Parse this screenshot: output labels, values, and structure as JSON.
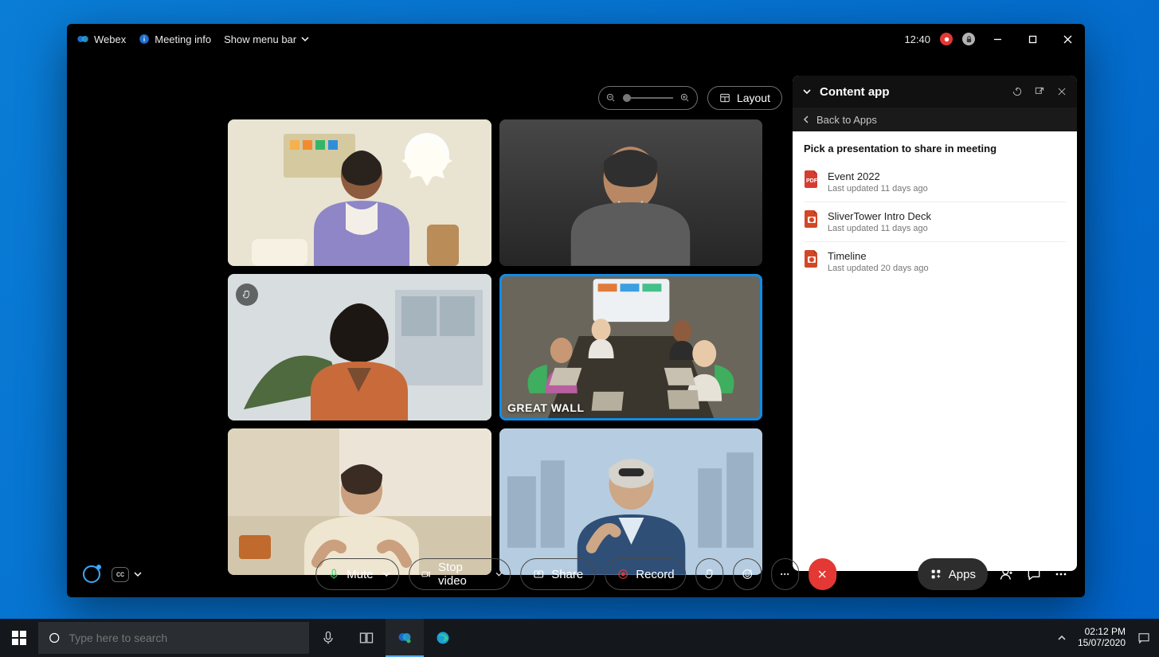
{
  "app": {
    "brand": "Webex",
    "meeting_info": "Meeting info",
    "menubar": "Show menu bar"
  },
  "header": {
    "time": "12:40",
    "layout": "Layout"
  },
  "tiles": {
    "row2col2_name": "GREAT WALL"
  },
  "panel": {
    "title": "Content app",
    "back": "Back to Apps",
    "prompt": "Pick a presentation to share in meeting",
    "items": [
      {
        "name": "Event 2022",
        "sub": "Last updated 11 days ago",
        "type": "pdf"
      },
      {
        "name": "SliverTower Intro Deck",
        "sub": "Last updated 11 days ago",
        "type": "ppt"
      },
      {
        "name": "Timeline",
        "sub": "Last updated 20 days ago",
        "type": "ppt"
      }
    ]
  },
  "bottom": {
    "mute": "Mute",
    "stop_video": "Stop video",
    "share": "Share",
    "record": "Record",
    "apps": "Apps"
  },
  "taskbar": {
    "search_placeholder": "Type here to search",
    "time": "02:12 PM",
    "date": "15/07/2020"
  }
}
